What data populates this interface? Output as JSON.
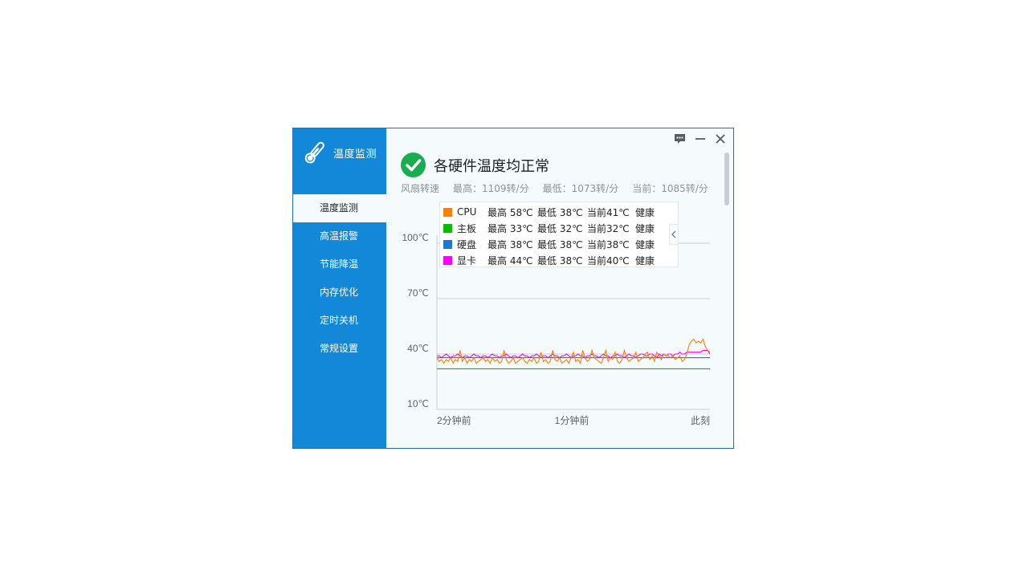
{
  "app": {
    "title": "温度监测"
  },
  "sidebar": {
    "items": [
      {
        "label": "温度监测",
        "active": true
      },
      {
        "label": "高温报警"
      },
      {
        "label": "节能降温"
      },
      {
        "label": "内存优化"
      },
      {
        "label": "定时关机"
      },
      {
        "label": "常规设置"
      }
    ]
  },
  "titlebar": {
    "icons": [
      "feedback-icon",
      "minimize-icon",
      "close-icon"
    ]
  },
  "status": {
    "text": "各硬件温度均正常",
    "icon": "check-circle-icon",
    "color": "#1aad50"
  },
  "fan": {
    "label": "风扇转速",
    "max": "最高：1109转/分",
    "min": "最低：1073转/分",
    "current": "当前：1085转/分"
  },
  "legend": {
    "rows": [
      {
        "name": "CPU",
        "color": "#ff7f00",
        "max": "最高 58℃",
        "min": "最低 38℃",
        "current": "当前41℃",
        "state": "健康"
      },
      {
        "name": "主板",
        "color": "#00c000",
        "max": "最高 33℃",
        "min": "最低 32℃",
        "current": "当前32℃",
        "state": "健康"
      },
      {
        "name": "硬盘",
        "color": "#1f77d4",
        "max": "最高 38℃",
        "min": "最低 38℃",
        "current": "当前38℃",
        "state": "健康"
      },
      {
        "name": "显卡",
        "color": "#ff00ff",
        "max": "最高 44℃",
        "min": "最低 38℃",
        "current": "当前40℃",
        "state": "健康"
      }
    ]
  },
  "chart_data": {
    "type": "line",
    "ylim": [
      10,
      100
    ],
    "yticks": [
      "100℃",
      "70℃",
      "40℃",
      "10℃"
    ],
    "xticks": [
      "2分钟前",
      "1分钟前",
      "此刻"
    ],
    "series": [
      {
        "name": "CPU",
        "color": "#ff7f00",
        "values": [
          38,
          36,
          37,
          35,
          37,
          36,
          38,
          35,
          37,
          36,
          42,
          36,
          38,
          35,
          37,
          36,
          38,
          35,
          36,
          37,
          38,
          36,
          37,
          35,
          38,
          36,
          37,
          35,
          36,
          42,
          37,
          35,
          36,
          38,
          35,
          36,
          37,
          38,
          36,
          35,
          37,
          36,
          38,
          35,
          36,
          41,
          36,
          37,
          35,
          36,
          42,
          37,
          36,
          38,
          35,
          36,
          37,
          35,
          38,
          41,
          36,
          37,
          35,
          42,
          38,
          36,
          37,
          42,
          38,
          37,
          36,
          35,
          38,
          42,
          36,
          38,
          37,
          41,
          36,
          35,
          37,
          42,
          38,
          36,
          37,
          38,
          41,
          36,
          37,
          38,
          40,
          41,
          37,
          39,
          36,
          41,
          39,
          37,
          40,
          39,
          39,
          38,
          39,
          37,
          38,
          39,
          36,
          37,
          40,
          45,
          47,
          48,
          46,
          47,
          46,
          48,
          44,
          42,
          41
        ]
      },
      {
        "name": "主板",
        "color": "#00c000",
        "values": [
          32,
          32,
          32,
          32,
          32,
          32,
          32,
          32,
          32,
          32,
          32,
          32,
          32,
          32,
          32,
          32,
          32,
          32,
          32,
          32,
          32,
          32,
          32,
          32,
          32,
          32,
          32,
          32,
          32,
          32,
          32,
          32,
          32,
          32,
          32,
          32,
          32,
          32,
          32,
          32,
          32,
          32,
          32,
          32,
          32,
          32,
          32,
          32,
          32,
          32,
          32,
          32,
          32,
          32,
          32,
          32,
          32,
          32,
          32,
          32,
          32,
          32,
          32,
          32,
          32,
          32,
          32,
          32,
          32,
          32,
          32,
          32,
          32,
          32,
          32,
          32,
          32,
          32,
          32,
          32,
          32,
          32,
          32,
          32,
          32,
          32,
          32,
          32,
          32,
          32,
          32,
          32,
          32,
          32,
          32,
          32,
          32,
          32,
          32,
          32,
          32,
          32,
          32,
          32,
          32,
          32,
          32,
          32,
          32,
          32,
          32,
          32,
          32,
          32,
          32,
          32,
          32,
          32,
          32
        ]
      },
      {
        "name": "硬盘",
        "color": "#1f77d4",
        "values": [
          38,
          38,
          38,
          38,
          38,
          38,
          38,
          38,
          38,
          38,
          38,
          38,
          38,
          38,
          38,
          38,
          38,
          38,
          38,
          38,
          38,
          38,
          38,
          38,
          38,
          38,
          38,
          38,
          38,
          38,
          38,
          38,
          38,
          38,
          38,
          38,
          38,
          38,
          38,
          38,
          38,
          38,
          38,
          38,
          38,
          38,
          38,
          38,
          38,
          38,
          38,
          38,
          38,
          38,
          38,
          38,
          38,
          38,
          38,
          38,
          38,
          38,
          38,
          38,
          38,
          38,
          38,
          38,
          38,
          38,
          38,
          38,
          38,
          38,
          38,
          38,
          38,
          38,
          38,
          38,
          38,
          38,
          38,
          38,
          38,
          38,
          38,
          38,
          38,
          38,
          38,
          38,
          38,
          38,
          38,
          38,
          38,
          38,
          38,
          38,
          38,
          38,
          38,
          38,
          38,
          38,
          38,
          38,
          38,
          38,
          38,
          38,
          38,
          38,
          38,
          38,
          38,
          38,
          38
        ]
      },
      {
        "name": "显卡",
        "color": "#ff00ff",
        "values": [
          39,
          39,
          38,
          39,
          40,
          39,
          38,
          39,
          39,
          40,
          39,
          38,
          39,
          39,
          38,
          39,
          40,
          39,
          39,
          38,
          39,
          39,
          38,
          39,
          40,
          39,
          39,
          38,
          39,
          39,
          40,
          39,
          38,
          39,
          39,
          38,
          39,
          40,
          39,
          39,
          38,
          39,
          39,
          40,
          39,
          38,
          39,
          39,
          38,
          39,
          40,
          39,
          39,
          38,
          39,
          39,
          40,
          39,
          38,
          39,
          39,
          40,
          39,
          39,
          38,
          39,
          39,
          40,
          39,
          39,
          38,
          39,
          40,
          39,
          39,
          38,
          39,
          39,
          40,
          39,
          39,
          38,
          39,
          40,
          39,
          39,
          38,
          39,
          40,
          40,
          39,
          39,
          40,
          40,
          39,
          38,
          40,
          39,
          40,
          39,
          40,
          40,
          39,
          40,
          40,
          41,
          40,
          40,
          41,
          41,
          41,
          41,
          41,
          41,
          41,
          42,
          42,
          42,
          40
        ]
      }
    ]
  }
}
